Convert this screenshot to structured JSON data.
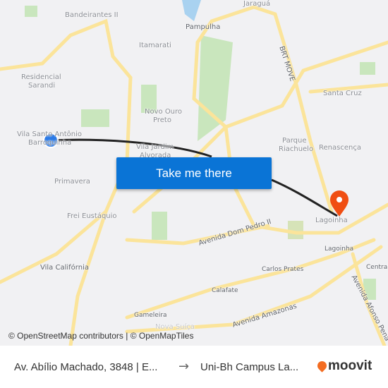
{
  "map": {
    "labels": [
      "Bandeirantes II",
      "Pampulha",
      "Itamarati",
      "Residencial",
      "Sarandi",
      "Santa Cruz",
      "Novo Ouro",
      "Preto",
      "Parque",
      "Riachuelo",
      "Renascença",
      "Vila Santo Antônio",
      "Barroquinha",
      "Vila Jardim",
      "Alvorada",
      "Primavera",
      "Frei Eustáquio",
      "Avenida Dom Pedro II",
      "Lagoinha",
      "Lagoinha",
      "Carlos Prates",
      "Calafate",
      "Gameleira",
      "Avenida Amazonas",
      "Vila Califórnia",
      "Central",
      "Avenida Afonso Pena",
      "BRT MOVE",
      "Jaraguá",
      "Nova Suíça"
    ],
    "route_color": "#222222",
    "origin_color": "#2b7ae6",
    "destination_color": "#f04e12",
    "road_color": "#fbe49a",
    "park_color": "#c9e6bd",
    "water_color": "#a9d2f0"
  },
  "cta": {
    "label": "Take me there",
    "color": "#0a74d6"
  },
  "attribution": "© OpenStreetMap contributors | © OpenMapTiles",
  "footer": {
    "from": "Av. Abílio Machado, 3848 | E...",
    "arrow_icon": "arrow-right-icon",
    "to": "Uni-Bh Campus La...",
    "logo": "moovit"
  }
}
